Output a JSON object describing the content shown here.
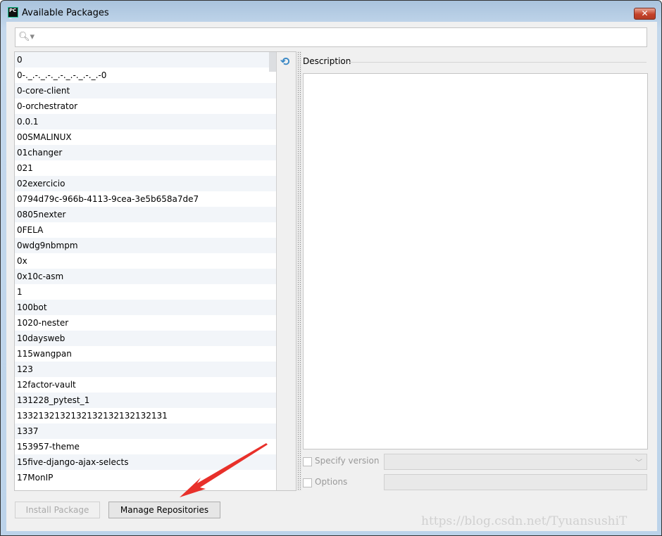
{
  "window": {
    "title": "Available Packages",
    "app_icon": "PC",
    "close_icon": "close-icon"
  },
  "search": {
    "value": "",
    "icon": "search-icon"
  },
  "packages": [
    "0",
    "0-._.-._.-._.-._.-._.-._.-0",
    "0-core-client",
    "0-orchestrator",
    "0.0.1",
    "00SMALINUX",
    "01changer",
    "021",
    "02exercicio",
    "0794d79c-966b-4113-9cea-3e5b658a7de7",
    "0805nexter",
    "0FELA",
    "0wdg9nbmpm",
    "0x",
    "0x10c-asm",
    "1",
    "100bot",
    "1020-nester",
    "10daysweb",
    "115wangpan",
    "123",
    "12factor-vault",
    "131228_pytest_1",
    "1332132132132132132132132131",
    "1337",
    "153957-theme",
    "15five-django-ajax-selects",
    "17MonIP"
  ],
  "refresh_icon": "refresh-icon",
  "description": {
    "label": "Description",
    "text": ""
  },
  "options": {
    "specify_version_label": "Specify version",
    "specify_version_checked": false,
    "version_value": "",
    "options_label": "Options",
    "options_checked": false,
    "options_value": ""
  },
  "buttons": {
    "install": "Install Package",
    "manage": "Manage Repositories"
  },
  "annotation": {
    "arrow_color": "#e8302a"
  },
  "watermark": "https://blog.csdn.net/TyuansushiT"
}
